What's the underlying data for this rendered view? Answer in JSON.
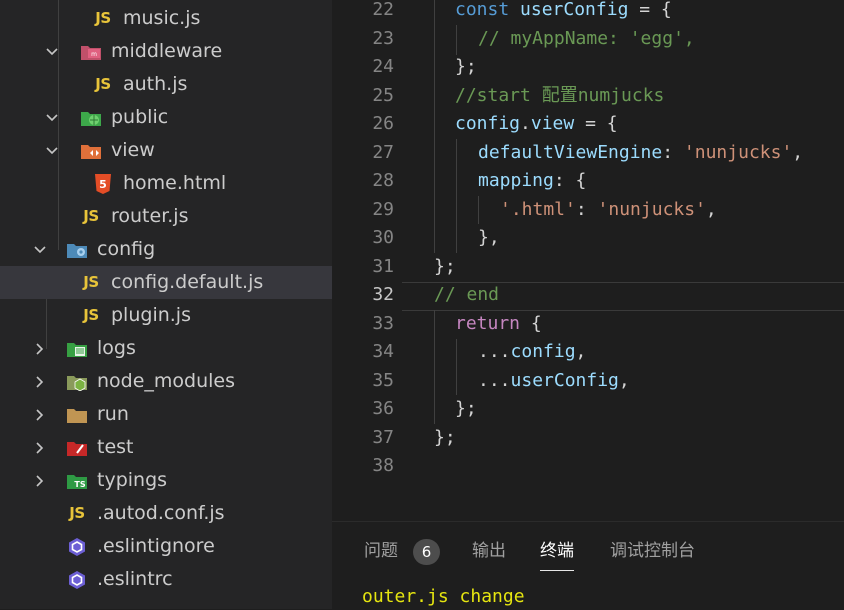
{
  "explorer": {
    "items": [
      {
        "label": "music.js",
        "icon": "js-file-icon",
        "chevron": "",
        "selected": false
      },
      {
        "label": "middleware",
        "icon": "middleware-folder-icon",
        "chevron": "open",
        "selected": false
      },
      {
        "label": "auth.js",
        "icon": "js-file-icon",
        "chevron": "",
        "selected": false
      },
      {
        "label": "public",
        "icon": "public-folder-icon",
        "chevron": "open",
        "selected": false
      },
      {
        "label": "view",
        "icon": "view-folder-icon",
        "chevron": "open",
        "selected": false
      },
      {
        "label": "home.html",
        "icon": "html-file-icon",
        "chevron": "",
        "selected": false
      },
      {
        "label": "router.js",
        "icon": "js-file-icon",
        "chevron": "",
        "selected": false
      },
      {
        "label": "config",
        "icon": "config-folder-icon",
        "chevron": "open",
        "selected": false
      },
      {
        "label": "config.default.js",
        "icon": "js-file-icon",
        "chevron": "",
        "selected": true
      },
      {
        "label": "plugin.js",
        "icon": "js-file-icon",
        "chevron": "",
        "selected": false
      },
      {
        "label": "logs",
        "icon": "logs-folder-icon",
        "chevron": "closed",
        "selected": false
      },
      {
        "label": "node_modules",
        "icon": "node-modules-folder-icon",
        "chevron": "closed",
        "selected": false
      },
      {
        "label": "run",
        "icon": "folder-icon",
        "chevron": "closed",
        "selected": false
      },
      {
        "label": "test",
        "icon": "test-folder-icon",
        "chevron": "closed",
        "selected": false
      },
      {
        "label": "typings",
        "icon": "typings-folder-icon",
        "chevron": "closed",
        "selected": false
      },
      {
        "label": ".autod.conf.js",
        "icon": "js-file-icon",
        "chevron": "",
        "selected": false
      },
      {
        "label": ".eslintignore",
        "icon": "eslint-icon",
        "chevron": "",
        "selected": false
      },
      {
        "label": ".eslintrc",
        "icon": "eslint-icon",
        "chevron": "",
        "selected": false
      }
    ],
    "js_badge": "JS",
    "html_badge": "5",
    "ts_badge": "TS"
  },
  "editor": {
    "active_line": "32",
    "lines": [
      {
        "no": "22",
        "tokens": [
          [
            "kw2",
            "const "
          ],
          [
            "var",
            "userConfig"
          ],
          [
            "pun",
            " = {"
          ]
        ]
      },
      {
        "no": "23",
        "tokens": [
          [
            "cmt",
            "// myAppName: 'egg',"
          ]
        ]
      },
      {
        "no": "24",
        "tokens": [
          [
            "pun",
            "};"
          ]
        ]
      },
      {
        "no": "25",
        "tokens": [
          [
            "cmt",
            "//start 配置numjucks"
          ]
        ]
      },
      {
        "no": "26",
        "tokens": [
          [
            "var",
            "config"
          ],
          [
            "pun",
            "."
          ],
          [
            "var",
            "view"
          ],
          [
            "pun",
            " = {"
          ]
        ]
      },
      {
        "no": "27",
        "tokens": [
          [
            "prop",
            "defaultViewEngine"
          ],
          [
            "pun",
            ": "
          ],
          [
            "str",
            "'nunjucks'"
          ],
          [
            "pun",
            ","
          ]
        ]
      },
      {
        "no": "28",
        "tokens": [
          [
            "prop",
            "mapping"
          ],
          [
            "pun",
            ": {"
          ]
        ]
      },
      {
        "no": "29",
        "tokens": [
          [
            "str",
            "'.html'"
          ],
          [
            "pun",
            ": "
          ],
          [
            "str",
            "'nunjucks'"
          ],
          [
            "pun",
            ","
          ]
        ]
      },
      {
        "no": "30",
        "tokens": [
          [
            "pun",
            "},"
          ]
        ]
      },
      {
        "no": "31",
        "tokens": [
          [
            "pun",
            "};"
          ]
        ]
      },
      {
        "no": "32",
        "tokens": [
          [
            "cmt",
            "// end"
          ]
        ]
      },
      {
        "no": "33",
        "tokens": [
          [
            "kw",
            "return"
          ],
          [
            "pun",
            " {"
          ]
        ]
      },
      {
        "no": "34",
        "tokens": [
          [
            "pun",
            "..."
          ],
          [
            "var",
            "config"
          ],
          [
            "pun",
            ","
          ]
        ]
      },
      {
        "no": "35",
        "tokens": [
          [
            "pun",
            "..."
          ],
          [
            "var",
            "userConfig"
          ],
          [
            "pun",
            ","
          ]
        ]
      },
      {
        "no": "36",
        "tokens": [
          [
            "pun",
            "};"
          ]
        ]
      },
      {
        "no": "37",
        "tokens": [
          [
            "pun",
            "};"
          ]
        ]
      },
      {
        "no": "38",
        "tokens": []
      }
    ]
  },
  "panel": {
    "tabs": [
      {
        "label": "问题",
        "active": false
      },
      {
        "label": "输出",
        "active": false
      },
      {
        "label": "终端",
        "active": true
      },
      {
        "label": "调试控制台",
        "active": false
      }
    ],
    "problems_count": "6",
    "terminal_text": "outer.js change"
  },
  "colors": {
    "sidebar_bg": "#252526",
    "editor_bg": "#1e1e1e",
    "selected_row": "#37373d",
    "keyword": "#c586c0",
    "storage": "#569cd6",
    "variable": "#9cdcfe",
    "string": "#ce9178",
    "comment": "#6a9955",
    "terminal_text": "#e5e510"
  }
}
